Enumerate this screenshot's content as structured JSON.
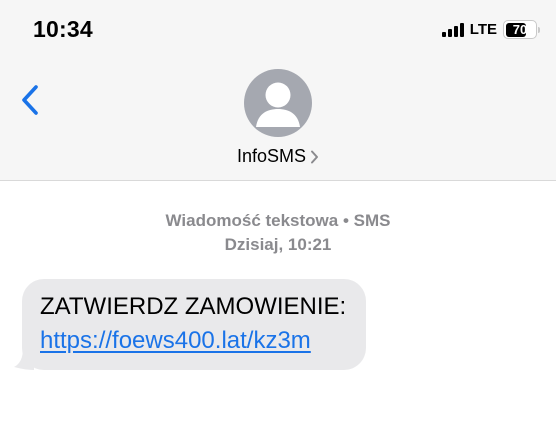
{
  "status_bar": {
    "time": "10:34",
    "network": "LTE",
    "battery_level": "70"
  },
  "header": {
    "back_icon": "chevron-left-icon",
    "avatar_icon": "person-icon",
    "contact_name": "InfoSMS",
    "contact_chevron": "chevron-right-icon"
  },
  "conversation": {
    "service_label": "Wiadomość tekstowa • SMS",
    "timestamp": "Dzisiaj, 10:21",
    "messages": [
      {
        "direction": "incoming",
        "text": "ZATWIERDZ ZAMOWIENIE:",
        "link": "https://foews400.lat/kz3m"
      }
    ]
  },
  "colors": {
    "link": "#1a73e8",
    "back_chevron": "#1a73e8",
    "bubble": "#e9e9eb",
    "meta_text": "#8a8a8e",
    "header_bg": "#f6f6f6",
    "avatar_bg": "#a5a8b0"
  }
}
